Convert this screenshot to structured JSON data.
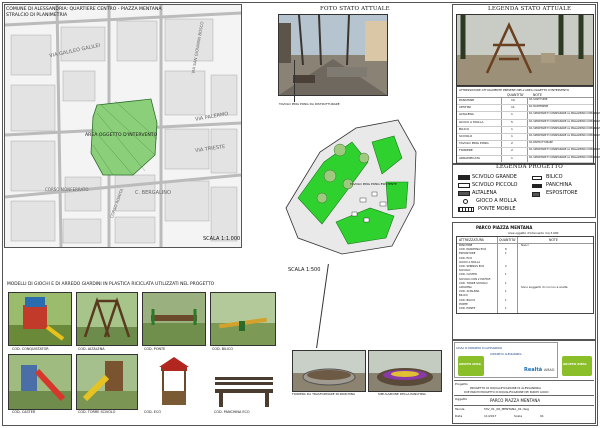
{
  "map": {
    "title1": "COMUNE DI ALESSANDRIA: QUARTIERE CENTRO - PIAZZA MENTANA",
    "title2": "STRALCIO DI PLANIMETRIA",
    "area_label": "AREA OGGETTO D'INTERVENTO",
    "streets": [
      "VIA GALILEO GALILEI",
      "VIA PALERMO",
      "VIA TRIESTE",
      "VIA SAN GIOVANNI BOSCO",
      "CORSO ROMITA",
      "C. BERGALINO",
      "CORSO MONFERRATO"
    ],
    "scale": "SCALA 1:1.000"
  },
  "plan": {
    "photo_title": "FOTO STATO ATTUALE",
    "note1": "TAVOLO PING PONG DA RISTRUTTURARE",
    "note2": "TAVOLO PING PONG ESISTENTE",
    "scale": "SCALA 1:500"
  },
  "legend_stato": {
    "title": "LEGENDA STATO ATTUALE",
    "table_title": "ATTREZZATURE ATTUALMENTE PRESENTI NELL'AREA OGGETTO D'INTERVENTO",
    "headers": [
      "",
      "QUANTITA'",
      "NOTE"
    ],
    "rows": [
      [
        "PANCHINE",
        "10",
        "DA SOSTITUIRE"
      ],
      [
        "CESTINI",
        "11",
        "DA MANTENERE"
      ],
      [
        "ALTALENA",
        "1",
        "DA SMONTARE E CONSEGNARE AL MAGAZZINO COMUNALE"
      ],
      [
        "GIOCO A MOLLA",
        "5",
        "DA SMONTARE E CONSEGNARE AL MAGAZZINO COMUNALE"
      ],
      [
        "BILICO",
        "1",
        "DA SMONTARE E CONSEGNARE AL MAGAZZINO COMUNALE"
      ],
      [
        "SCIVOLO",
        "1",
        "DA SMONTARE E CONSEGNARE AL MAGAZZINO COMUNALE"
      ],
      [
        "TAVOLO PING PONG",
        "2",
        "DA RISTRUTTURARE"
      ],
      [
        "FIORIERE",
        "2",
        "DA SMONTARE E CONSEGNARE AL MAGAZZINO COMUNALE"
      ],
      [
        "ARRAMPICATA",
        "1",
        "DA SMONTARE E CONSEGNARE AL MAGAZZINO COMUNALE"
      ]
    ]
  },
  "legend_progetto": {
    "title": "LEGENDA PROGETTO",
    "items": [
      "SCIVOLO GRANDE",
      "SCIVOLO PICCOLO",
      "ALTALENA",
      "GIOCO A MOLLA",
      "PONTE MOBILE",
      "BILICO",
      "PANCHINA",
      "ESPOSITORE"
    ]
  },
  "parco": {
    "title": "PARCO PIAZZA MENTANA",
    "area_note": "Area oggetto d'intervento mq 3.000",
    "headers": [
      "ATTREZZATURA",
      "QUANTITA'",
      "NOTE"
    ],
    "rows": [
      [
        "PANCHINE",
        "",
        "Nuovi"
      ],
      [
        "COD. PANCHINA ECO",
        "8",
        ""
      ],
      [
        "ESPOSITORE",
        "1",
        ""
      ],
      [
        "COD. ECO",
        "",
        ""
      ],
      [
        "GIOCO A MOLLA",
        "",
        ""
      ],
      [
        "COD. SPRINGS ECO",
        "2",
        ""
      ],
      [
        "SCIVOLO",
        "",
        ""
      ],
      [
        "COD. CASTER",
        "1",
        ""
      ],
      [
        "SCIVOLO CON 2 PIATTAF.",
        "",
        ""
      ],
      [
        "COD. TORRE SCIVOLO",
        "1",
        ""
      ],
      [
        "ALTALENA",
        "",
        ""
      ],
      [
        "COD. ALTALENA",
        "1",
        ""
      ],
      [
        "BILICO",
        "",
        ""
      ],
      [
        "COD. BILICO",
        "1",
        ""
      ],
      [
        "PONTE",
        "",
        ""
      ],
      [
        "COD. PONTE",
        "1",
        ""
      ]
    ],
    "side_note": "Sono suggeriti di cui non a scelta"
  },
  "models": {
    "title": "MODELLI DI GIOCHI E DI ARREDO GIARDINI IN PLASTICA RICICLATA UTILIZZATI NEL PROGETTO",
    "row1": [
      "COD. CONQUISTATOR",
      "COD. ALTALENA",
      "COD. PONTE",
      "COD. BILICO"
    ],
    "row2": [
      "COD. CASTER",
      "COD. TORRE SCIVOLO",
      "COD. ECO",
      "COD. PANCHINA ECO"
    ]
  },
  "bottom_photos": {
    "cap1": "FIORIERA DA TRASFORMARE IN PANCHINA",
    "cap2": "SIMULAZIONE DELLA PANCHINA"
  },
  "title_block": {
    "logo1": "CASSA DI RISPARMIO DI ALESSANDRIA",
    "logo2": "COMUNE DI ALESSANDRIA",
    "logo3": "Realtà",
    "logo4": "AMAG",
    "green1": "GRUPPO AMAG",
    "green2": "GRUPPO AMAG",
    "project_label": "Progetto",
    "project": "PROGETTO DI RIQUALIFICAZIONE DI ALESSANDRIA",
    "project2": "DUE PARCHI PROGETTO DI RIQUALIFICAZIONE DEI PARCHI GIOCO",
    "subject_label": "Oggetto",
    "subject": "PARCO PIAZZA MENTANA",
    "tav_label": "Tavola",
    "tav": "TAV_01_06_MENTANA_01.dwg",
    "date_label": "Data",
    "date": "11/2017",
    "scale_label": "Scala",
    "sheet": "01"
  }
}
